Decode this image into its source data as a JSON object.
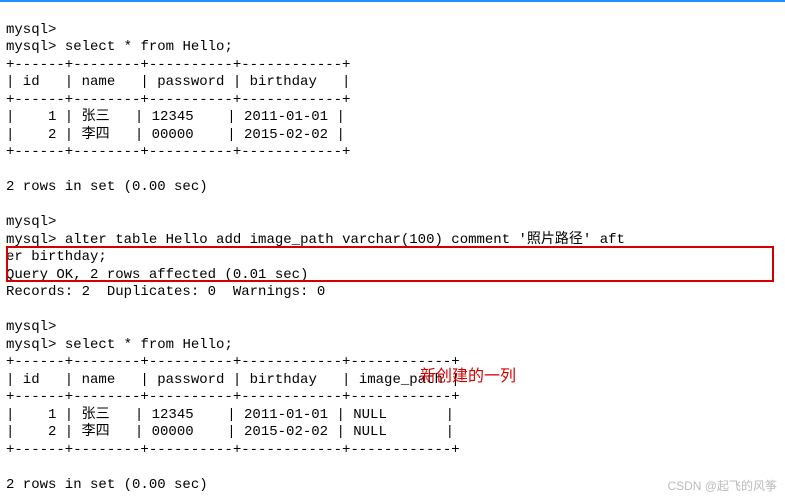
{
  "prompt": "mysql>",
  "query1": "select * from Hello;",
  "table1": {
    "border_top": "+------+--------+----------+------------+",
    "header": "| id   | name   | password | birthday   |",
    "border_mid": "+------+--------+----------+------------+",
    "rows": [
      "|    1 | 张三   | 12345    | 2011-01-01 |",
      "|    2 | 李四   | 00000    | 2015-02-02 |"
    ],
    "border_bot": "+------+--------+----------+------------+"
  },
  "result1": "2 rows in set (0.00 sec)",
  "alter_cmd_line1": "alter table Hello add image_path varchar(100) comment '照片路径' aft",
  "alter_cmd_line2": "er birthday;",
  "alter_result1": "Query OK, 2 rows affected (0.01 sec)",
  "alter_result2": "Records: 2  Duplicates: 0  Warnings: 0",
  "query2": "select * from Hello;",
  "table2": {
    "border_top": "+------+--------+----------+------------+------------+",
    "header": "| id   | name   | password | birthday   | image_path |",
    "border_mid": "+------+--------+----------+------------+------------+",
    "rows": [
      "|    1 | 张三   | 12345    | 2011-01-01 | NULL       |",
      "|    2 | 李四   | 00000    | 2015-02-02 | NULL       |"
    ],
    "border_bot": "+------+--------+----------+------------+------------+"
  },
  "result2": "2 rows in set (0.00 sec)",
  "annotation": "新创建的一列",
  "watermark": "CSDN @起飞的风筝"
}
